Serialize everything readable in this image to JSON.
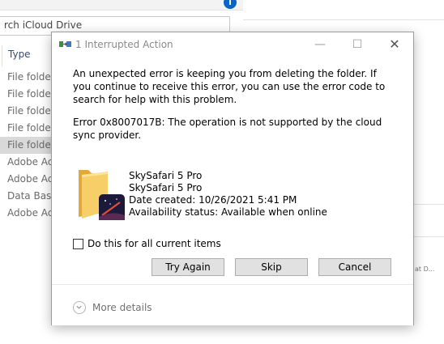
{
  "explorer": {
    "search_placeholder": "rch iCloud Drive",
    "column_type": "Type",
    "rows": [
      "File folder",
      "File folder",
      "File folder",
      "File folder",
      "File folder",
      "Adobe Acr",
      "Adobe Acr",
      "Data Base",
      "Adobe Acr"
    ],
    "selected_row_index": 4,
    "help_glyph": "i"
  },
  "right_panel": {
    "fragment": "at D..."
  },
  "dialog": {
    "title": "1 Interrupted Action",
    "controls": {
      "minimize": "—",
      "maximize": "☐",
      "close": "✕"
    },
    "message": "An unexpected error is keeping you from deleting the folder. If you continue to receive this error, you can use the error code to search for help with this problem.",
    "error": "Error 0x8007017B: The operation is not supported by the cloud sync provider.",
    "item": {
      "name": "SkySafari 5 Pro",
      "subtitle": "SkySafari 5 Pro",
      "date_created": "Date created: 10/26/2021 5:41 PM",
      "availability": "Availability status: Available when online"
    },
    "checkbox_label": "Do this for all current items",
    "checkbox_checked": false,
    "buttons": {
      "try_again": "Try Again",
      "skip": "Skip",
      "cancel": "Cancel"
    },
    "more_details": "More details"
  },
  "colors": {
    "folder_yellow": "#f3c85a",
    "app_icon_dark": "#1b1a3a",
    "help_blue": "#0a64c8"
  }
}
